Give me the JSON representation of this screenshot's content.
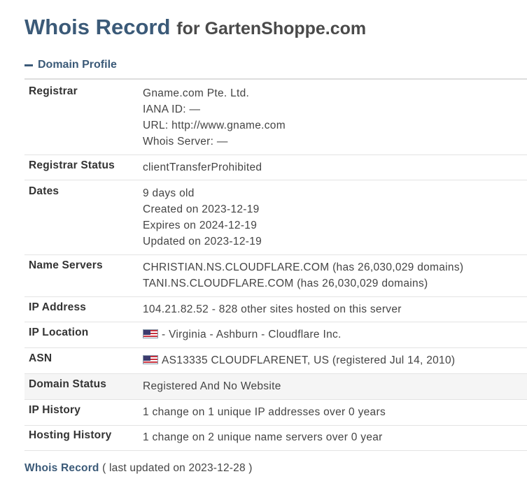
{
  "title": {
    "main": "Whois Record",
    "for": "for GartenShoppe.com"
  },
  "section": {
    "label": "Domain Profile"
  },
  "rows": [
    {
      "label": "Registrar",
      "lines": [
        "Gname.com Pte. Ltd.",
        "IANA ID: —",
        "URL: http://www.gname.com",
        "Whois Server: —"
      ]
    },
    {
      "label": "Registrar Status",
      "lines": [
        "clientTransferProhibited"
      ]
    },
    {
      "label": "Dates",
      "lines": [
        "9 days old",
        "Created on 2023-12-19",
        "Expires on 2024-12-19",
        "Updated on 2023-12-19"
      ]
    },
    {
      "label": "Name Servers",
      "lines": [
        "CHRISTIAN.NS.CLOUDFLARE.COM (has 26,030,029 domains)",
        "TANI.NS.CLOUDFLARE.COM (has 26,030,029 domains)"
      ]
    },
    {
      "label": "IP Address",
      "lines": [
        "104.21.82.52 - 828 other sites hosted on this server"
      ]
    },
    {
      "label": "IP Location",
      "lines": [
        "- Virginia - Ashburn - Cloudflare Inc."
      ],
      "flag": "us-flag-icon"
    },
    {
      "label": "ASN",
      "lines": [
        "AS13335 CLOUDFLARENET, US (registered Jul 14, 2010)"
      ],
      "flag": "us-flag-icon"
    },
    {
      "label": "Domain Status",
      "lines": [
        "Registered And No Website"
      ]
    },
    {
      "label": "IP History",
      "lines": [
        "1 change on 1 unique IP addresses over 0 years"
      ]
    },
    {
      "label": "Hosting History",
      "lines": [
        "1 change on 2 unique name servers over 0 year"
      ]
    }
  ],
  "footer": {
    "link": "Whois Record",
    "note": "( last updated on 2023-12-28 )"
  },
  "colors": {
    "title": "#3b5a78",
    "link": "#3b5a78",
    "shaded_row": "#f5f5f5"
  }
}
